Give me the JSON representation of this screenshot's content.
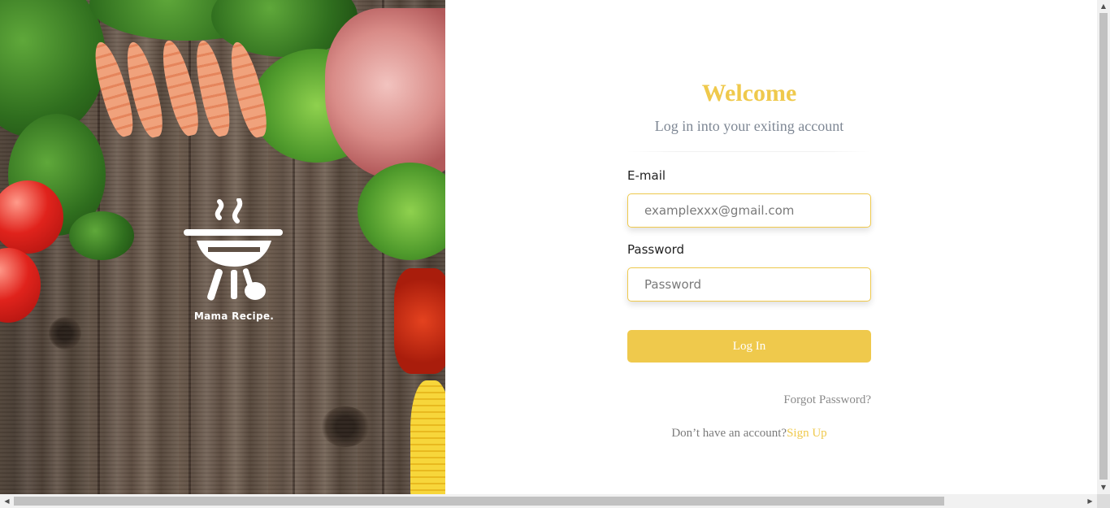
{
  "brand": {
    "name": "Mama Recipe."
  },
  "login": {
    "title": "Welcome",
    "subtitle": "Log in into your exiting account",
    "email_label": "E-mail",
    "email_placeholder": "examplexxx@gmail.com",
    "password_label": "Password",
    "password_placeholder": "Password",
    "submit_label": "Log In",
    "forgot_label": "Forgot Password?",
    "no_account_text": "Don’t have an account?",
    "signup_label": "Sign Up"
  },
  "colors": {
    "accent": "#efc94c",
    "subtitle": "#7e8794",
    "muted": "#8a8a8a"
  },
  "icons": {
    "logo": "grill-icon",
    "scroll_up": "triangle-up-icon",
    "scroll_down": "triangle-down-icon",
    "scroll_left": "triangle-left-icon",
    "scroll_right": "triangle-right-icon"
  }
}
